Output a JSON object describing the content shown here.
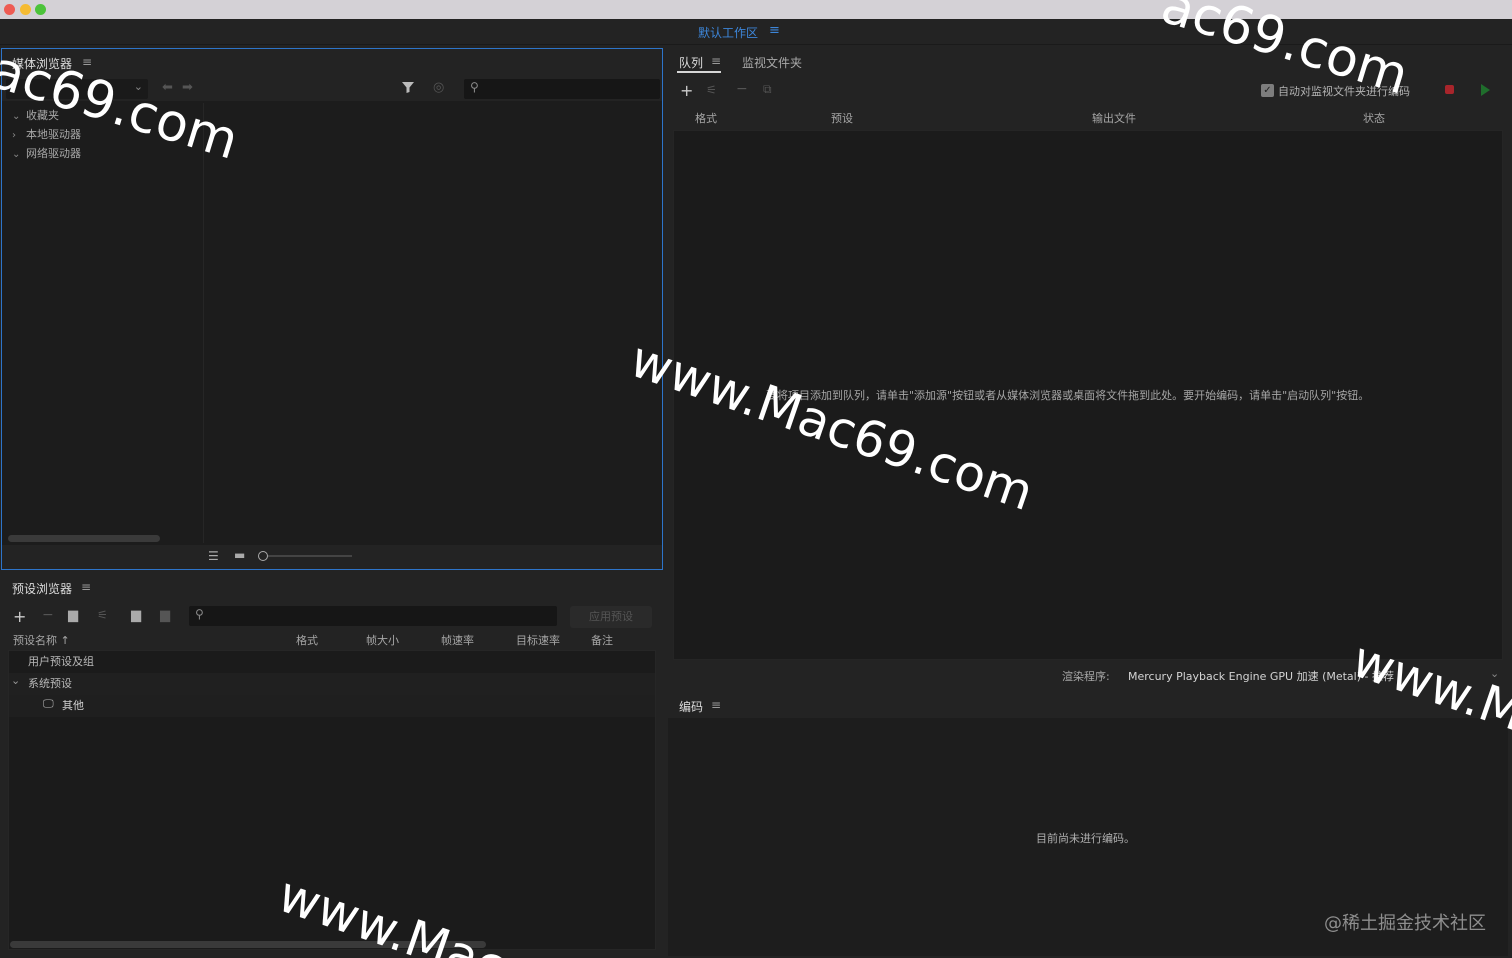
{
  "window": {
    "traffic_lights": {
      "close": "#ee5b53",
      "minimize": "#f5bb33",
      "maximize": "#4cc33a"
    }
  },
  "workspace": {
    "label": "默认工作区",
    "menu_icon": "hamburger-icon"
  },
  "media_browser": {
    "title": "媒体浏览器",
    "tree": [
      {
        "label": "收藏夹",
        "expanded": true
      },
      {
        "label": "本地驱动器",
        "expanded": false
      },
      {
        "label": "网络驱动器",
        "expanded": true
      }
    ]
  },
  "queue": {
    "tabs": [
      {
        "label": "队列",
        "active": true
      },
      {
        "label": "监视文件夹",
        "active": false
      }
    ],
    "auto_encode_label": "自动对监视文件夹进行编码",
    "auto_encode_checked": true,
    "columns": [
      "格式",
      "预设",
      "输出文件",
      "状态"
    ],
    "empty_message": "要将项目添加到队列，请单击\"添加源\"按钮或者从媒体浏览器或桌面将文件拖到此处。要开始编码，请单击\"启动队列\"按钮。",
    "renderer_label": "渲染程序:",
    "renderer_value": "Mercury Playback Engine GPU 加速 (Metal) - 推荐",
    "stop_color": "#a8252b",
    "start_color": "#1f6e2c"
  },
  "preset_browser": {
    "title": "预设浏览器",
    "apply_button": "应用预设",
    "columns": [
      "预设名称 ↑",
      "格式",
      "帧大小",
      "帧速率",
      "目标速率",
      "备注"
    ],
    "rows": [
      {
        "label": "用户预设及组",
        "indent": 0,
        "chevron": ""
      },
      {
        "label": "系统预设",
        "indent": 0,
        "chevron": "⌄"
      },
      {
        "label": "其他",
        "indent": 1,
        "chevron": ""
      }
    ]
  },
  "encoding": {
    "title": "编码",
    "empty_message": "目前尚未进行编码。"
  },
  "watermarks": {
    "mac69_top": "ac69.com",
    "mac69_top_right": "ac69.com",
    "mac69_center": "www.Mac69.com",
    "mac69_right": "www.M",
    "mac69_bottom": "www.Mac",
    "juejin": "@稀土掘金技术社区"
  }
}
